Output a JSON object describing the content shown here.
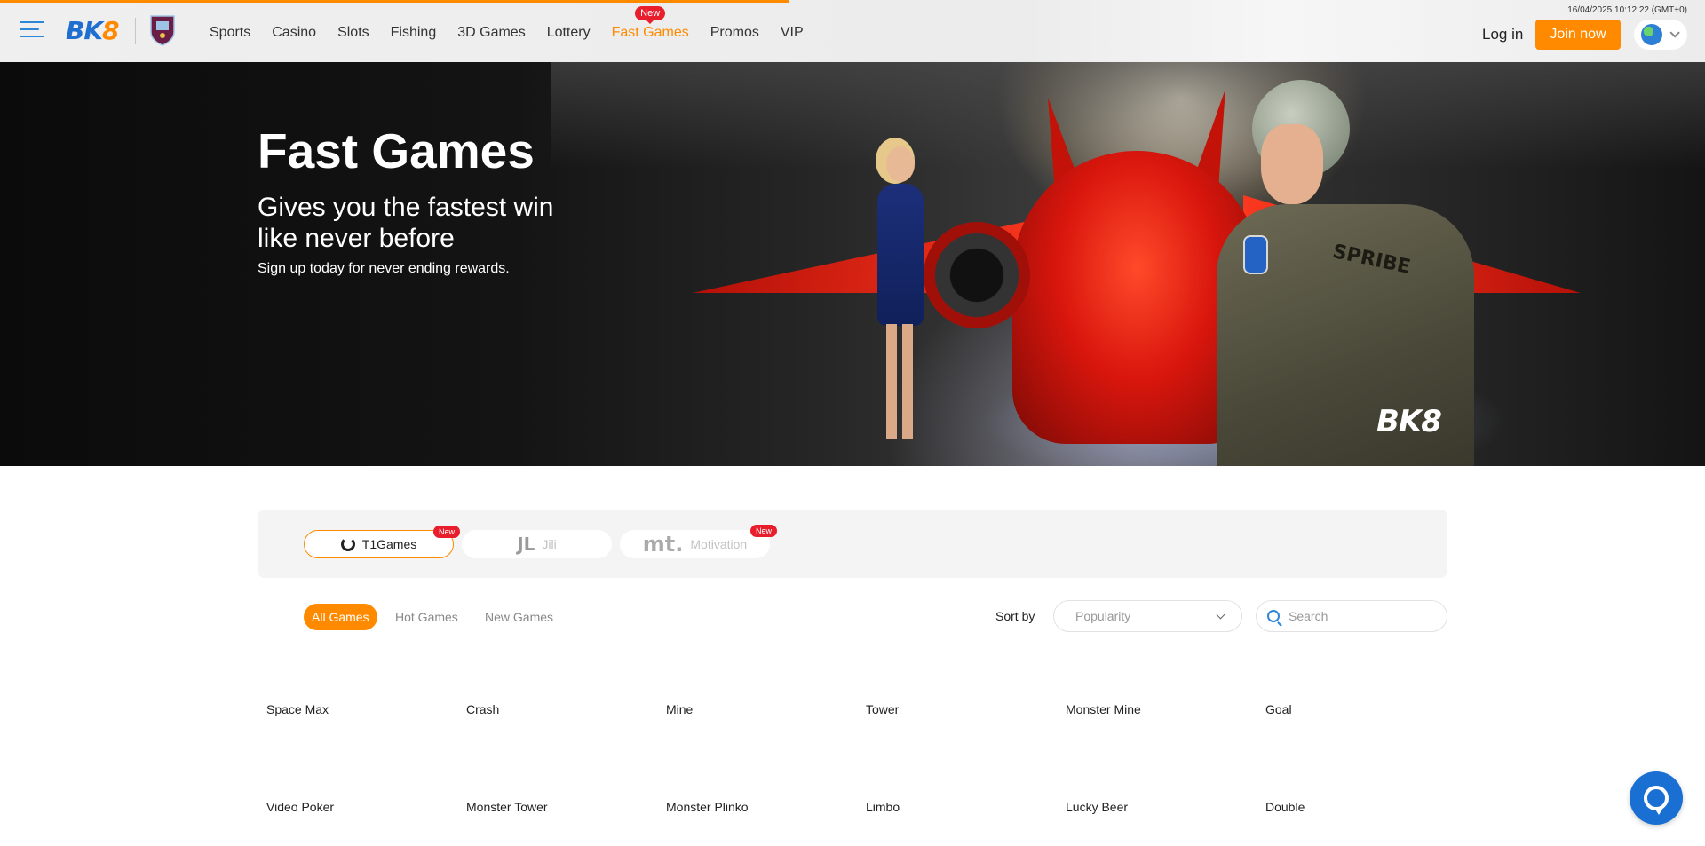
{
  "header": {
    "logo_text": "BK8",
    "datetime": "16/04/2025 10:12:22  (GMT+0)",
    "nav": [
      {
        "label": "Sports"
      },
      {
        "label": "Casino"
      },
      {
        "label": "Slots"
      },
      {
        "label": "Fishing"
      },
      {
        "label": "3D Games"
      },
      {
        "label": "Lottery"
      },
      {
        "label": "Fast Games",
        "badge": "New",
        "active": true
      },
      {
        "label": "Promos"
      },
      {
        "label": "VIP"
      }
    ],
    "login_label": "Log in",
    "join_label": "Join now",
    "accent_color": "#ff8a00",
    "brand_color": "#1f6fd0",
    "icons": {
      "menu": "hamburger-icon",
      "crest": "club-crest-icon",
      "globe": "globe-icon",
      "chevron": "chevron-down-icon"
    }
  },
  "hero": {
    "title": "Fast Games",
    "subtitle_line1": "Gives you the fastest win",
    "subtitle_line2": "like never before",
    "tagline": "Sign up today for never ending rewards.",
    "logo_text": "BK8",
    "patch_text": "SPRIBE"
  },
  "providers": [
    {
      "label": "T1Games",
      "badge": "New",
      "active": true
    },
    {
      "label": "Jili",
      "icon_text": "JL",
      "badge": "",
      "active": false
    },
    {
      "label": "Motivation",
      "icon_text": "mt.",
      "badge": "New",
      "active": false
    }
  ],
  "filters": {
    "tabs": [
      {
        "label": "All Games",
        "active": true
      },
      {
        "label": "Hot Games",
        "active": false
      },
      {
        "label": "New Games",
        "active": false
      }
    ],
    "sort_label": "Sort by",
    "sort_value": "Popularity",
    "search_placeholder": "Search"
  },
  "games": [
    [
      "Space Max",
      "Crash",
      "Mine",
      "Tower",
      "Monster Mine",
      "Goal"
    ],
    [
      "Video Poker",
      "Monster Tower",
      "Monster Plinko",
      "Limbo",
      "Lucky Beer",
      "Double"
    ]
  ],
  "chat": {
    "icon": "chat-bubble-icon"
  }
}
